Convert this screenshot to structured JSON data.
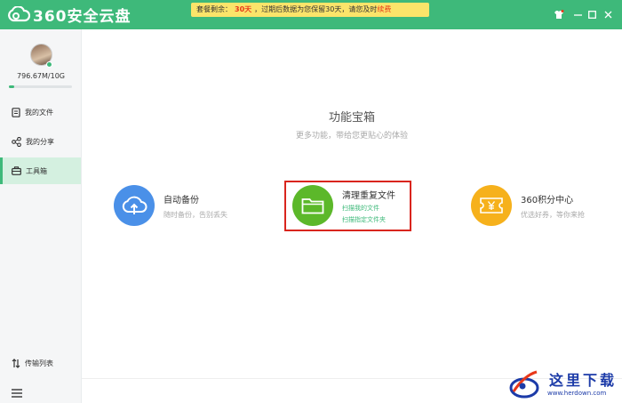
{
  "app": {
    "name": "360安全云盘"
  },
  "notice": {
    "prefix": "套餐剩余：",
    "days": "30天",
    "middle": "，过期后数据为您保留30天，请您及时",
    "renew": "续费"
  },
  "sidebar": {
    "quota": "796.67M/10G",
    "quota_fraction": 0.08,
    "items": [
      {
        "label": "我的文件",
        "icon": "file-icon"
      },
      {
        "label": "我的分享",
        "icon": "share-icon"
      },
      {
        "label": "工具箱",
        "icon": "toolbox-icon",
        "active": true
      }
    ],
    "transfer_label": "传输列表"
  },
  "main": {
    "title": "功能宝箱",
    "subtitle": "更多功能，带给您更贴心的体验",
    "tools": [
      {
        "name": "自动备份",
        "desc": "随时备份，告别丢失",
        "icon": "cloud-upload-icon",
        "color": "#4a90e8"
      },
      {
        "name": "清理重复文件",
        "link1": "扫描我的文件",
        "link2": "扫描指定文件夹",
        "icon": "folder-icon",
        "color": "#5cb82a"
      },
      {
        "name": "360积分中心",
        "desc": "优选好券，等你来抢",
        "icon": "yen-ticket-icon",
        "color": "#f6b11c"
      }
    ]
  },
  "watermark": {
    "title": "这里下载",
    "url": "www.herdown.com"
  },
  "colors": {
    "accent": "#3eb97a",
    "highlight": "#d9251d"
  }
}
